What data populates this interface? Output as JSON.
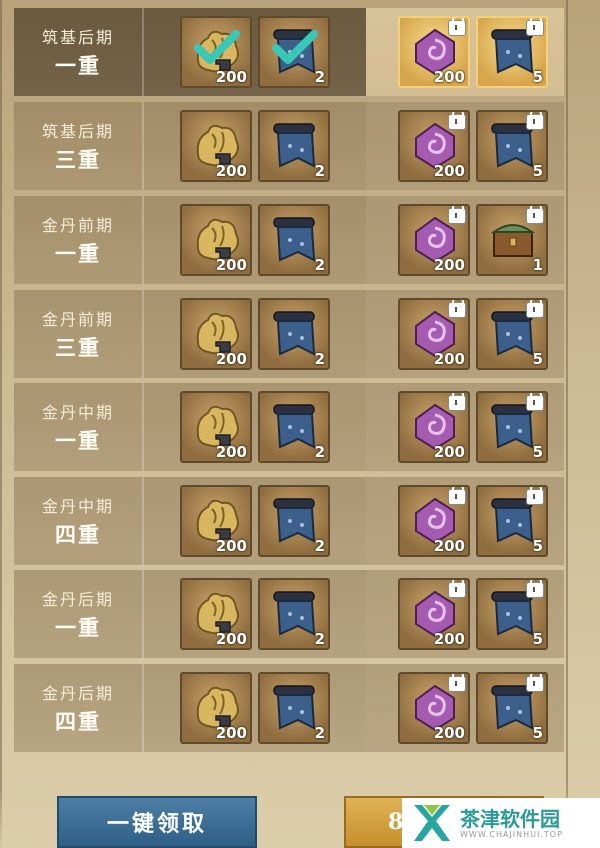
{
  "rows": [
    {
      "stage": "筑基后期",
      "level": "一重",
      "active": true,
      "claimed": true,
      "free": [
        {
          "icon": "rock-material-icon",
          "count": "200"
        },
        {
          "icon": "scroll-banner-icon",
          "count": "2"
        }
      ],
      "premium": [
        {
          "icon": "purple-jade-icon",
          "count": "200"
        },
        {
          "icon": "scroll-banner-icon",
          "count": "5"
        }
      ]
    },
    {
      "stage": "筑基后期",
      "level": "三重",
      "active": false,
      "claimed": false,
      "free": [
        {
          "icon": "rock-material-icon",
          "count": "200"
        },
        {
          "icon": "scroll-banner-icon",
          "count": "2"
        }
      ],
      "premium": [
        {
          "icon": "purple-jade-icon",
          "count": "200"
        },
        {
          "icon": "scroll-banner-icon",
          "count": "5"
        }
      ]
    },
    {
      "stage": "金丹前期",
      "level": "一重",
      "active": false,
      "claimed": false,
      "free": [
        {
          "icon": "rock-material-icon",
          "count": "200"
        },
        {
          "icon": "scroll-banner-icon",
          "count": "2"
        }
      ],
      "premium": [
        {
          "icon": "purple-jade-icon",
          "count": "200"
        },
        {
          "icon": "treasure-chest-icon",
          "count": "1"
        }
      ]
    },
    {
      "stage": "金丹前期",
      "level": "三重",
      "active": false,
      "claimed": false,
      "free": [
        {
          "icon": "rock-material-icon",
          "count": "200"
        },
        {
          "icon": "scroll-banner-icon",
          "count": "2"
        }
      ],
      "premium": [
        {
          "icon": "purple-jade-icon",
          "count": "200"
        },
        {
          "icon": "scroll-banner-icon",
          "count": "5"
        }
      ]
    },
    {
      "stage": "金丹中期",
      "level": "一重",
      "active": false,
      "claimed": false,
      "free": [
        {
          "icon": "rock-material-icon",
          "count": "200"
        },
        {
          "icon": "scroll-banner-icon",
          "count": "2"
        }
      ],
      "premium": [
        {
          "icon": "purple-jade-icon",
          "count": "200"
        },
        {
          "icon": "scroll-banner-icon",
          "count": "5"
        }
      ]
    },
    {
      "stage": "金丹中期",
      "level": "四重",
      "active": false,
      "claimed": false,
      "free": [
        {
          "icon": "rock-material-icon",
          "count": "200"
        },
        {
          "icon": "scroll-banner-icon",
          "count": "2"
        }
      ],
      "premium": [
        {
          "icon": "purple-jade-icon",
          "count": "200"
        },
        {
          "icon": "scroll-banner-icon",
          "count": "5"
        }
      ]
    },
    {
      "stage": "金丹后期",
      "level": "一重",
      "active": false,
      "claimed": false,
      "free": [
        {
          "icon": "rock-material-icon",
          "count": "200"
        },
        {
          "icon": "scroll-banner-icon",
          "count": "2"
        }
      ],
      "premium": [
        {
          "icon": "purple-jade-icon",
          "count": "200"
        },
        {
          "icon": "scroll-banner-icon",
          "count": "5"
        }
      ]
    },
    {
      "stage": "金丹后期",
      "level": "四重",
      "active": false,
      "claimed": false,
      "free": [
        {
          "icon": "rock-material-icon",
          "count": "200"
        },
        {
          "icon": "scroll-banner-icon",
          "count": "2"
        }
      ],
      "premium": [
        {
          "icon": "purple-jade-icon",
          "count": "200"
        },
        {
          "icon": "scroll-banner-icon",
          "count": "5"
        }
      ]
    }
  ],
  "footer": {
    "claim_all_label": "一键领取",
    "price_label": "8"
  },
  "watermark": {
    "name": "茶津软件园",
    "site": "WWW.CHAJINHUI.TOP"
  },
  "colors": {
    "claimed_check": "#39c7b6",
    "premium_gold": "#e9c46e",
    "claim_button": "#2f5f86"
  }
}
